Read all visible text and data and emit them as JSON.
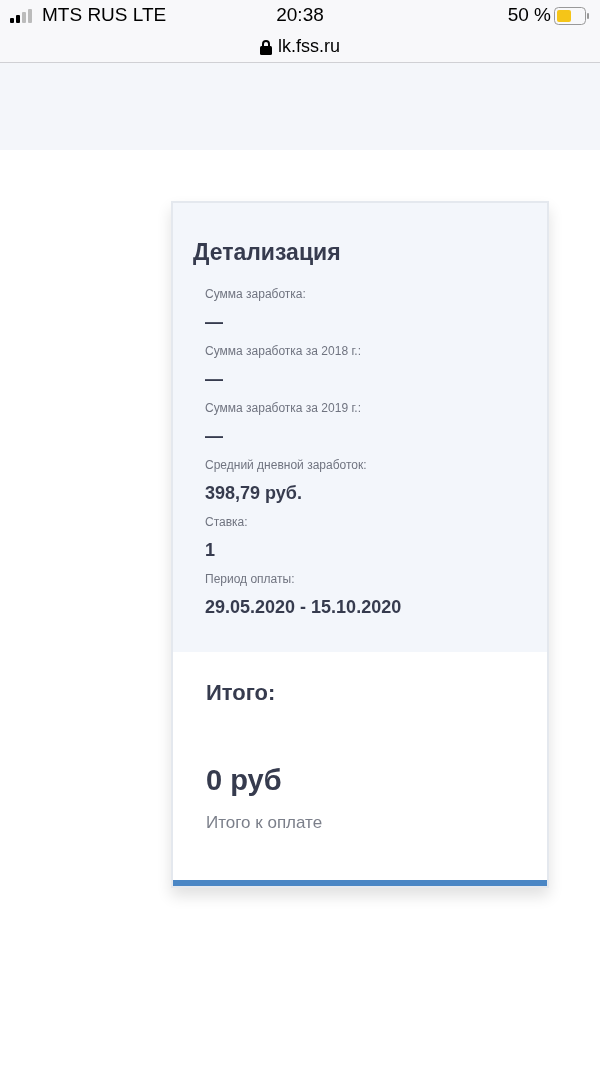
{
  "status_bar": {
    "carrier": "MTS RUS LTE",
    "time": "20:38",
    "battery": "50 %"
  },
  "address_bar": {
    "url": "lk.fss.ru"
  },
  "card": {
    "title": "Детализация",
    "fields": [
      {
        "label": "Сумма заработка:",
        "value": "—"
      },
      {
        "label": "Сумма заработка за 2018 г.:",
        "value": "—"
      },
      {
        "label": "Сумма заработка за 2019 г.:",
        "value": "—"
      },
      {
        "label": "Средний дневной заработок:",
        "value": "398,79 руб."
      },
      {
        "label": "Ставка:",
        "value": "1"
      },
      {
        "label": "Период оплаты:",
        "value": "29.05.2020 - 15.10.2020"
      }
    ],
    "total": {
      "heading": "Итого:",
      "amount": "0 руб",
      "caption": "Итого к оплате"
    }
  }
}
